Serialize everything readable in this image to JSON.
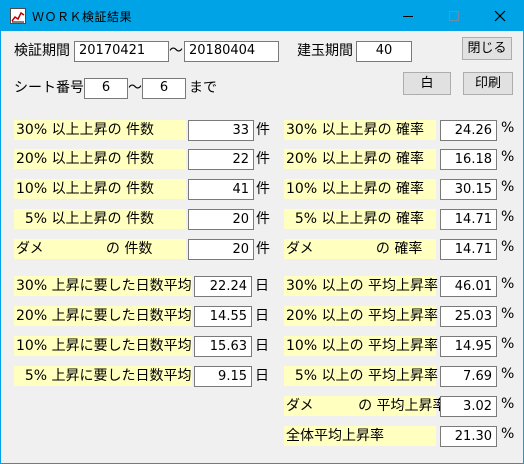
{
  "window": {
    "title": "ＷＯＲＫ検証結果"
  },
  "header": {
    "verify_period_label": "検証期間",
    "date_from": "20170421",
    "tilde1": "～",
    "date_to": "20180404",
    "position_period_label": "建玉期間",
    "position_period": "40",
    "close_label": "閉じる",
    "sheet_label": "シート番号",
    "sheet_from": "6",
    "tilde2": "～",
    "sheet_to": "6",
    "made_label": "まで",
    "white_label": "白",
    "print_label": "印刷"
  },
  "counts": [
    {
      "label": "30% 以上上昇の 件数",
      "value": "33",
      "unit": "件"
    },
    {
      "label": "20% 以上上昇の 件数",
      "value": "22",
      "unit": "件"
    },
    {
      "label": "10% 以上上昇の 件数",
      "value": "41",
      "unit": "件"
    },
    {
      "label": "  5% 以上上昇の 件数",
      "value": "20",
      "unit": "件"
    },
    {
      "label": "ダメ              の 件数",
      "value": "20",
      "unit": "件"
    }
  ],
  "rates": [
    {
      "label": "30% 以上上昇の 確率",
      "value": "24.26",
      "unit": "%"
    },
    {
      "label": "20% 以上上昇の 確率",
      "value": "16.18",
      "unit": "%"
    },
    {
      "label": "10% 以上上昇の 確率",
      "value": "30.15",
      "unit": "%"
    },
    {
      "label": "  5% 以上上昇の 確率",
      "value": "14.71",
      "unit": "%"
    },
    {
      "label": "ダメ              の 確率",
      "value": "14.71",
      "unit": "%"
    }
  ],
  "days": [
    {
      "label": "30% 上昇に要した日数平均",
      "value": "22.24",
      "unit": "日"
    },
    {
      "label": "20% 上昇に要した日数平均",
      "value": "14.55",
      "unit": "日"
    },
    {
      "label": "10% 上昇に要した日数平均",
      "value": "15.63",
      "unit": "日"
    },
    {
      "label": "  5% 上昇に要した日数平均",
      "value": "9.15",
      "unit": "日"
    }
  ],
  "avg_rise": [
    {
      "label": "30% 以上の 平均上昇率",
      "value": "46.01",
      "unit": "%"
    },
    {
      "label": "20% 以上の 平均上昇率",
      "value": "25.03",
      "unit": "%"
    },
    {
      "label": "10% 以上の 平均上昇率",
      "value": "14.95",
      "unit": "%"
    },
    {
      "label": "  5% 以上の 平均上昇率",
      "value": "7.69",
      "unit": "%"
    },
    {
      "label": "ダメ          の 平均上昇率",
      "value": "3.02",
      "unit": "%"
    },
    {
      "label": "全体平均上昇率",
      "value": "21.30",
      "unit": "%"
    }
  ],
  "colors": {
    "titlebar": "#00a3e6",
    "label_bg": "#ffffc0",
    "window_bg": "#f0f0f0"
  }
}
